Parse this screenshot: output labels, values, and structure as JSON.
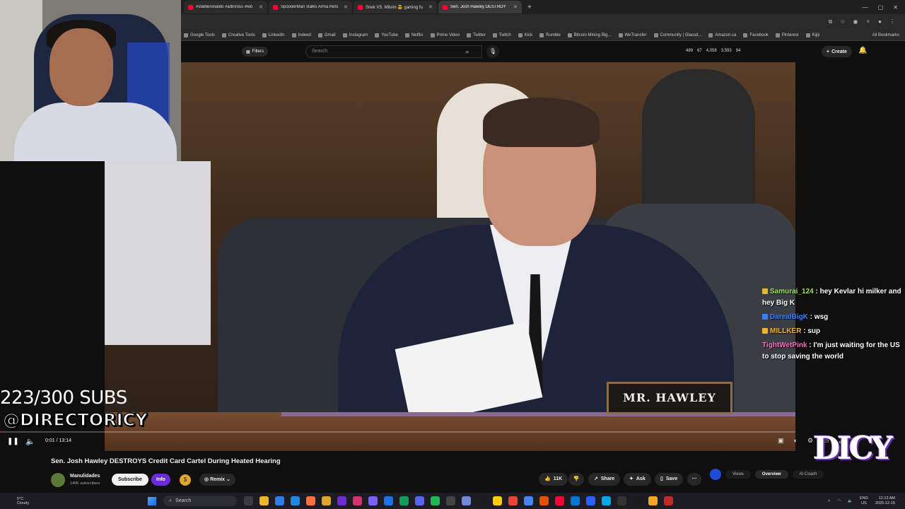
{
  "browser": {
    "tabs": [
      {
        "title": "#stableronaldo #adinross #leb",
        "active": false
      },
      {
        "title": "SpooderMan stalks Arma Refo",
        "active": false
      },
      {
        "title": "Snek VS. Milsim 😎 gaming fu",
        "active": false
      },
      {
        "title": "Sen. Josh Hawley DESTROY",
        "active": true
      }
    ],
    "bookmarks": [
      "Google Tools",
      "Creative Tools",
      "LinkedIn",
      "Indeed",
      "Gmail",
      "Instagram",
      "YouTube",
      "Netflix",
      "Prime Video",
      "Twitter",
      "Twitch",
      "Kick",
      "Rumble",
      "Bitcoin Mining Big...",
      "WeTransfer",
      "Community | Glassd...",
      "Amazon.ca",
      "Facebook",
      "Pinterest",
      "Kijiji"
    ],
    "all_bookmarks": "All Bookmarks"
  },
  "youtube_header": {
    "filters_label": "Filters",
    "search_placeholder": "Search",
    "stats": [
      "489",
      "67",
      "4,058",
      "3,593",
      "94"
    ],
    "create_label": "Create"
  },
  "video": {
    "nameplate": "MR. HAWLEY",
    "time_display": "0:01 / 13:14",
    "progress_fraction": 0.0013
  },
  "overlay": {
    "subs_goal": "223/300 SUBS",
    "handle": "@DIRECTORICY",
    "logo_text": "DICY"
  },
  "chat": [
    {
      "user": "Samurai_124",
      "color": "#9de35b",
      "badge_color": "#e3b92c",
      "message": "hey Kevlar hi milker and hey Big K"
    },
    {
      "user": "DarealBigK",
      "color": "#3b82f6",
      "badge_color": "#3b82f6",
      "message": "wsg"
    },
    {
      "user": "MILLKER",
      "color": "#f0b429",
      "badge_color": "#f0b429",
      "message": "sup"
    },
    {
      "user": "TightWetPink",
      "color": "#f472b6",
      "badge_color": "",
      "message": "I'm just waiting for the US to stop saving the world"
    }
  ],
  "video_info": {
    "title": "Sen. Josh Hawley DESTROYS Credit Card Cartel During Heated Hearing",
    "channel_name": "Manulidades",
    "channel_subs": "140K subscribers",
    "subscribe_label": "Subscribe",
    "join_label": "Info",
    "remix_label": "Remix",
    "like_count": "11K",
    "share_label": "Share",
    "ask_label": "Ask",
    "save_label": "Save",
    "side_tabs": [
      "Views",
      "Overview",
      "AI Coach"
    ]
  },
  "taskbar": {
    "weather_temp": "5°C",
    "weather_desc": "Cloudy",
    "search_label": "Search",
    "lang": "ENG",
    "region": "US",
    "time": "12:13 AM",
    "date": "2025-12-15"
  }
}
